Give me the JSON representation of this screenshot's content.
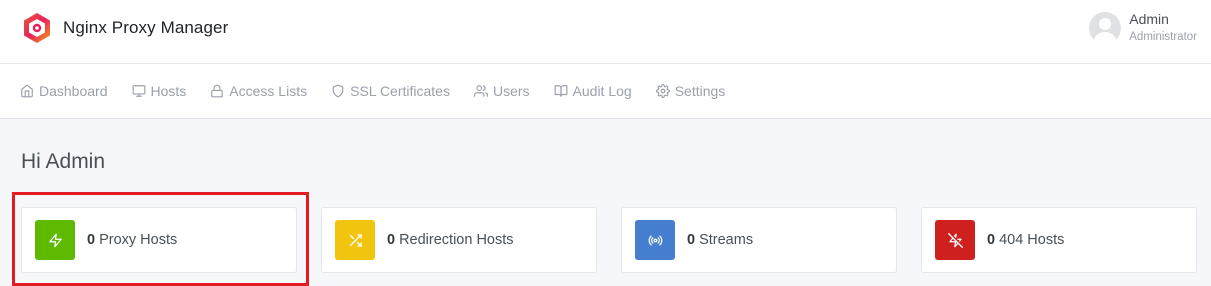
{
  "app": {
    "title": "Nginx Proxy Manager"
  },
  "user": {
    "name": "Admin",
    "role": "Administrator"
  },
  "nav": [
    {
      "label": "Dashboard",
      "icon": "home-icon"
    },
    {
      "label": "Hosts",
      "icon": "monitor-icon"
    },
    {
      "label": "Access Lists",
      "icon": "lock-icon"
    },
    {
      "label": "SSL Certificates",
      "icon": "shield-icon"
    },
    {
      "label": "Users",
      "icon": "users-icon"
    },
    {
      "label": "Audit Log",
      "icon": "book-icon"
    },
    {
      "label": "Settings",
      "icon": "settings-icon"
    }
  ],
  "greeting": "Hi Admin",
  "cards": [
    {
      "count": "0",
      "label": "Proxy Hosts",
      "icon": "zap-icon",
      "color": "#5eba00"
    },
    {
      "count": "0",
      "label": "Redirection Hosts",
      "icon": "shuffle-icon",
      "color": "#f1c40f"
    },
    {
      "count": "0",
      "label": "Streams",
      "icon": "radio-icon",
      "color": "#467fcf"
    },
    {
      "count": "0",
      "label": "404 Hosts",
      "icon": "zap-off-icon",
      "color": "#cd201f"
    }
  ],
  "highlight_color": "#e41b23"
}
